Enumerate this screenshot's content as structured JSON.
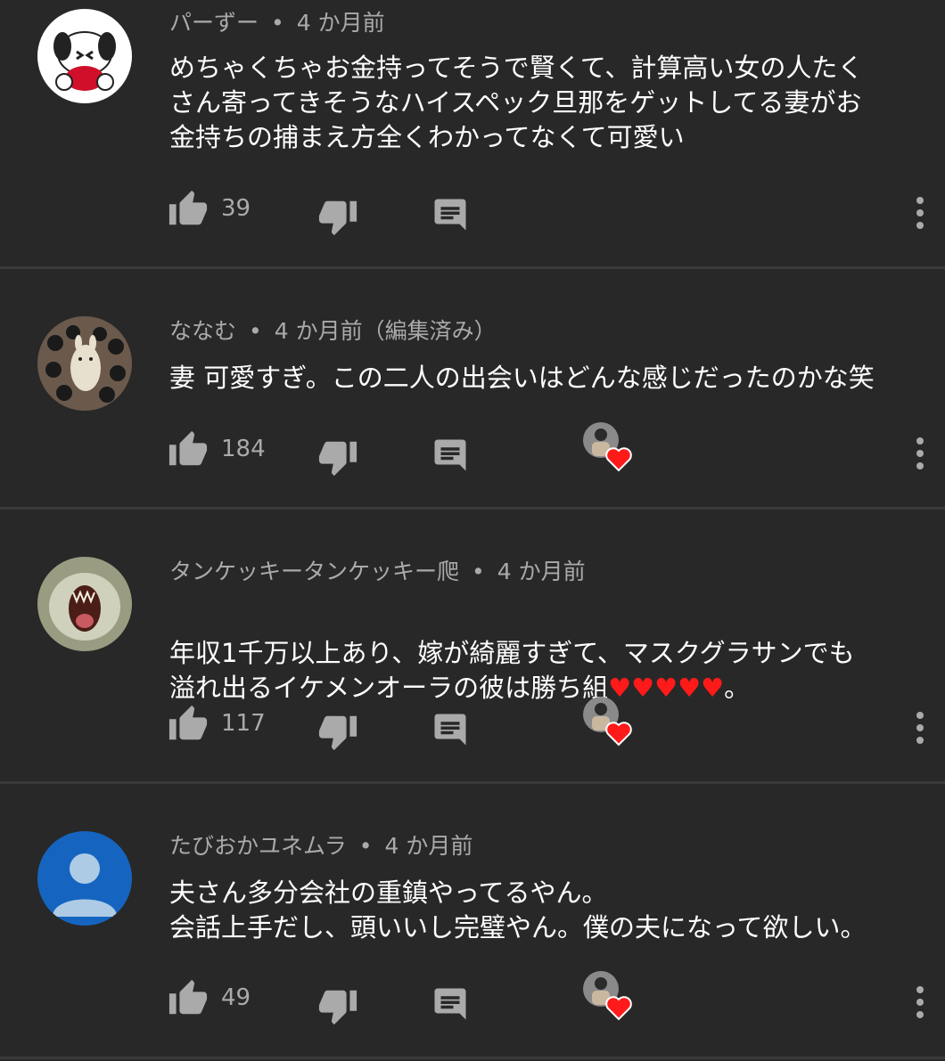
{
  "comments": [
    {
      "author": "パーずー",
      "separator": "•",
      "time": "4 か月前",
      "text": "めちゃくちゃお金持ってそうで賢くて、計算高い女の人たく\nさん寄ってきそうなハイスペック旦那をゲットしてる妻がお\n金持ちの捕まえ方全くわかってなくて可愛い",
      "likes": "39",
      "avatar": "pochacco-avatar",
      "creator_heart": false
    },
    {
      "author": "ななむ",
      "separator": "•",
      "time": "4 か月前（編集済み）",
      "text": "妻 可愛すぎ。この二人の出会いはどんな感じだったのかな笑",
      "likes": "184",
      "avatar": "totoro-avatar",
      "creator_heart": true
    },
    {
      "author": "タンケッキータンケッキー爬",
      "separator": "•",
      "time": "4 か月前",
      "text_line1": "年収1千万以上あり、嫁が綺麗すぎて、マスクグラサンでも",
      "text_line2": "溢れ出るイケメンオーラの彼は勝ち組",
      "text_hearts": "♥♥♥♥♥",
      "text_end": "。",
      "likes": "117",
      "avatar": "cat-avatar",
      "creator_heart": true
    },
    {
      "author": "たびおかユネムラ",
      "separator": "•",
      "time": "4 か月前",
      "text": "夫さん多分会社の重鎮やってるやん。\n会話上手だし、頭いいし完璧やん。僕の夫になって欲しい。",
      "likes": "49",
      "avatar": "default-person-avatar",
      "creator_heart": true
    }
  ],
  "colors": {
    "background": "#282828",
    "divider": "#3a3a3a",
    "meta_text": "#aaaaaa",
    "icon": "#aaaaaa",
    "heart": "#ff1a1a",
    "default_avatar_bg": "#1565c0"
  }
}
